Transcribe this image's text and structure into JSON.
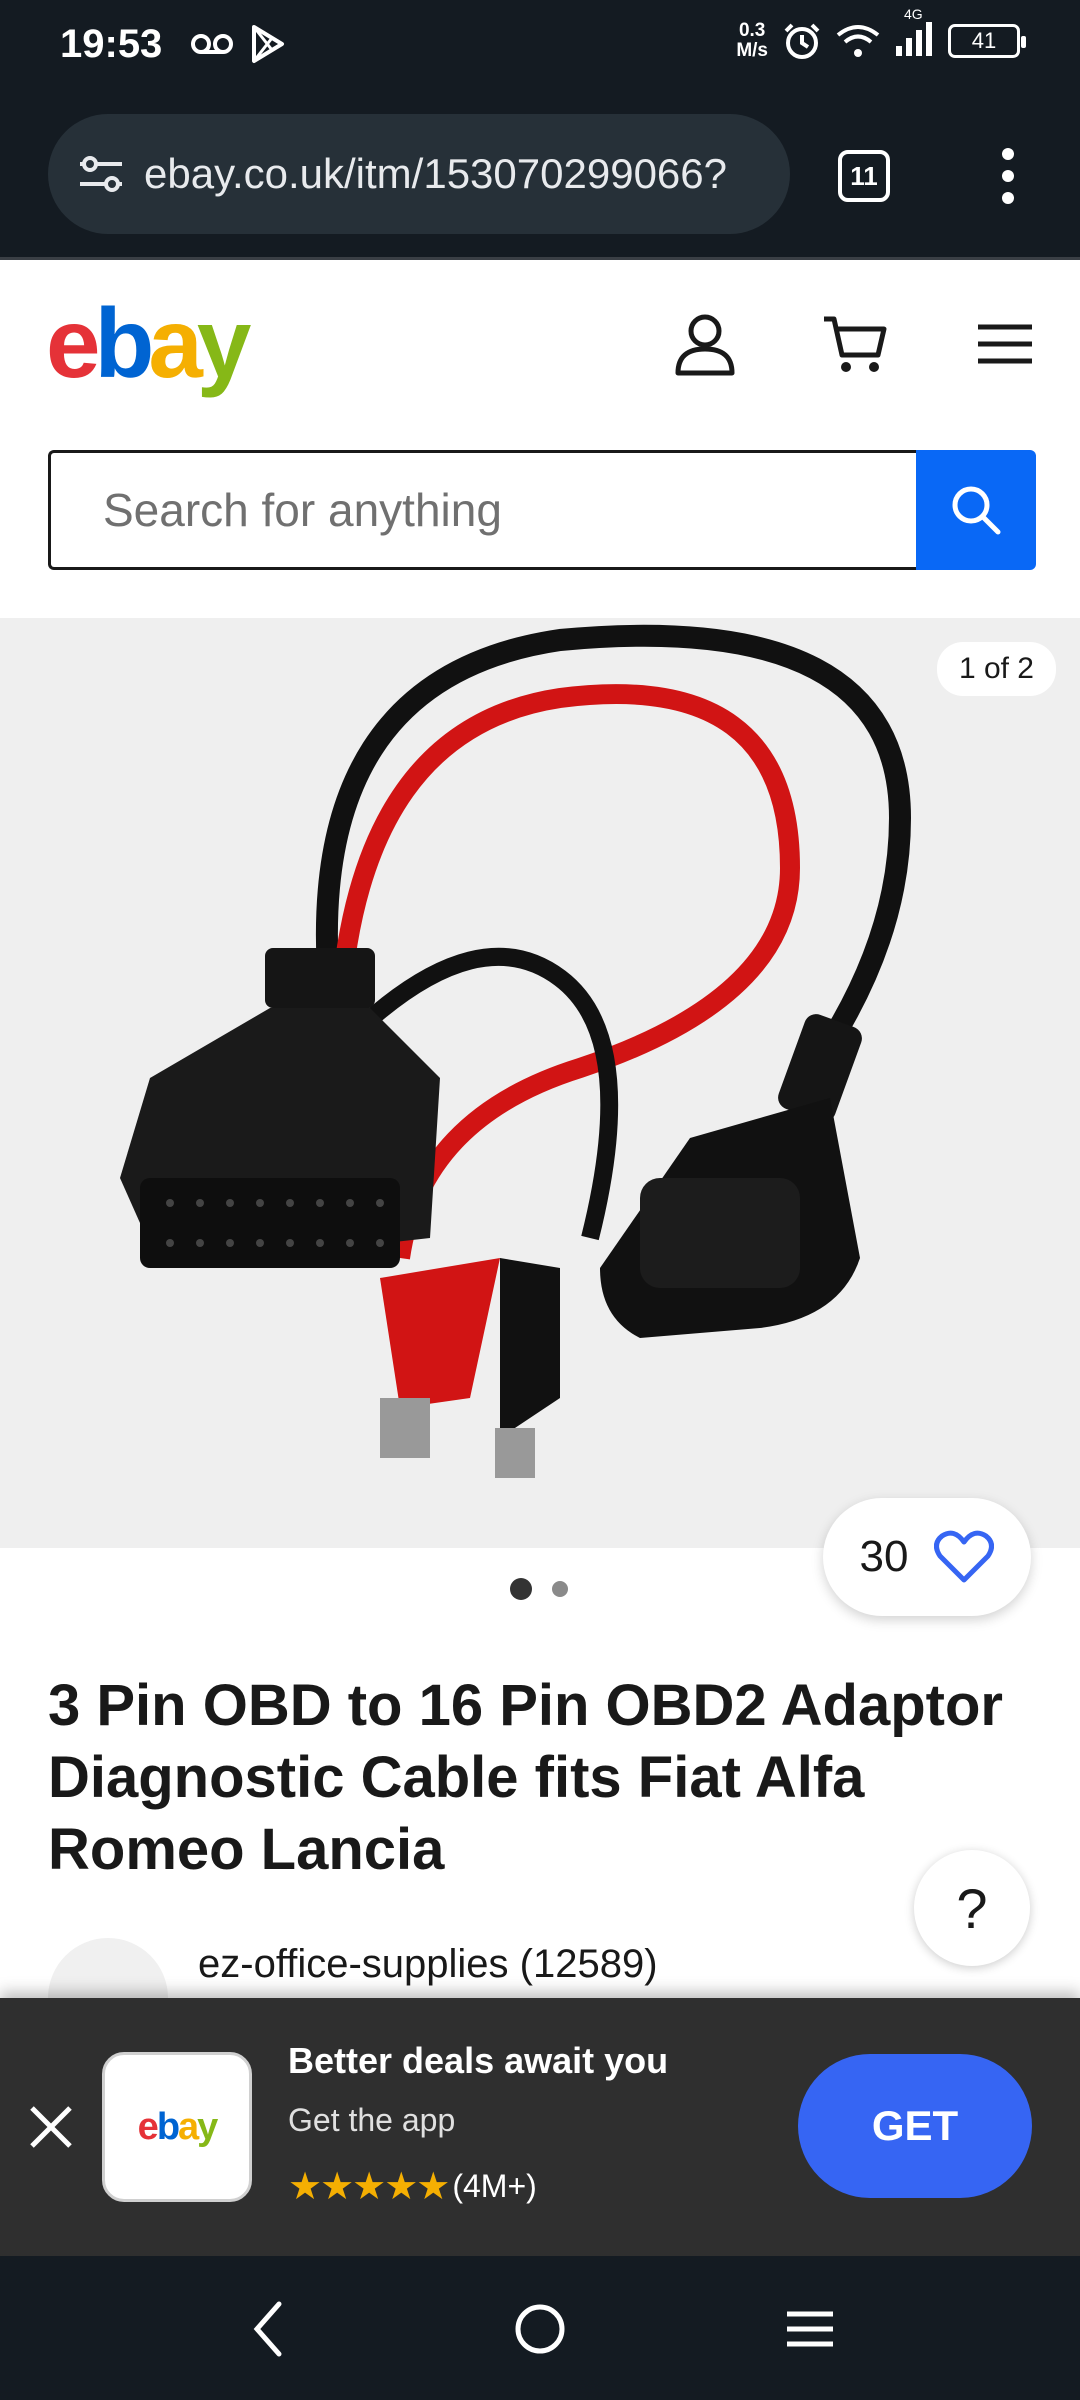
{
  "status_bar": {
    "time": "19:53",
    "network_speed_value": "0.3",
    "network_speed_unit": "M/s",
    "network_type": "4G",
    "battery": "41"
  },
  "browser": {
    "url": "ebay.co.uk/itm/153070299066?",
    "tab_count": "11"
  },
  "header": {
    "logo": {
      "e": "e",
      "b": "b",
      "a": "a",
      "y": "y"
    },
    "search_placeholder": "Search for anything"
  },
  "gallery": {
    "counter": "1 of 2",
    "watch_count": "30",
    "dots_total": 2,
    "dots_active": 1,
    "image_icon": "obd-cable-photo"
  },
  "product": {
    "title": "3 Pin OBD to 16 Pin OBD2 Adaptor Diagnostic Cable fits Fiat Alfa Romeo Lancia",
    "seller": "ez-office-supplies (12589)"
  },
  "app_banner": {
    "title": "Better deals await you",
    "subtitle": "Get the app",
    "stars": "★★★★★",
    "rating_count": "(4M+)",
    "get_label": "GET"
  },
  "colors": {
    "accent": "#3665f3",
    "search_button": "#0968f6",
    "heart": "#3665f3",
    "chrome": "#141b22"
  }
}
